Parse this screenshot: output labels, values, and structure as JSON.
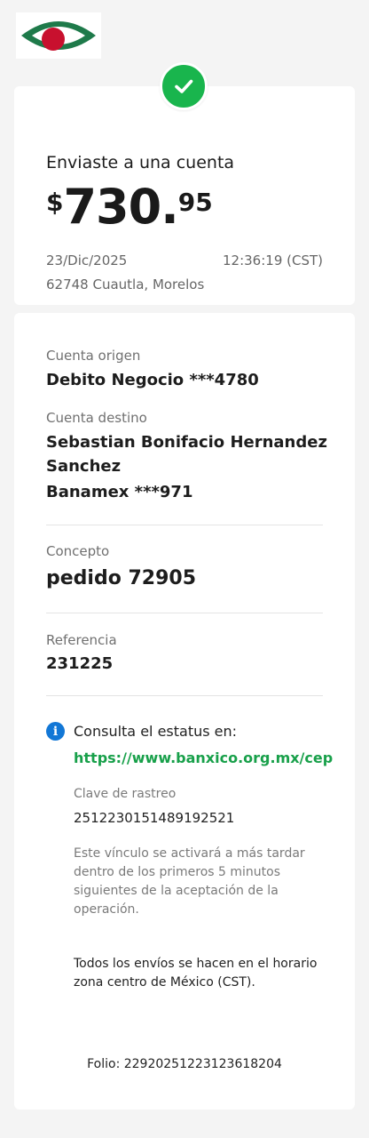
{
  "brand": {
    "primary": "#19b54d",
    "logo_green": "#1e7a4a",
    "logo_red": "#c8102e"
  },
  "receipt": {
    "title": "Enviaste a una cuenta",
    "amount": {
      "currency": "$",
      "integer": "730.",
      "decimals": "95"
    },
    "date": "23/Dic/2025",
    "time": "12:36:19 (CST)",
    "location": "62748 Cuautla, Morelos"
  },
  "details": {
    "origin_label": "Cuenta origen",
    "origin_value": "Debito Negocio ***4780",
    "dest_label": "Cuenta destino",
    "dest_name_line1": "Sebastian Bonifacio Hernandez",
    "dest_name_line2": "Sanchez",
    "dest_bank": "Banamex ***971",
    "concept_label": "Concepto",
    "concept_value": "pedido 72905",
    "reference_label": "Referencia",
    "reference_value": "231225"
  },
  "status": {
    "info_glyph": "i",
    "consult_text": "Consulta el estatus en:",
    "link": "https://www.banxico.org.mx/cep",
    "tracking_label": "Clave de rastreo",
    "tracking_value": "2512230151489192521",
    "note": "Este vínculo se activará a más tardar dentro de los primeros 5 minutos siguientes de la aceptación de la operación.",
    "timezone_note": "Todos los envíos se hacen en el horario zona centro de México (CST).",
    "folio": "Folio: 22920251223123618204"
  }
}
